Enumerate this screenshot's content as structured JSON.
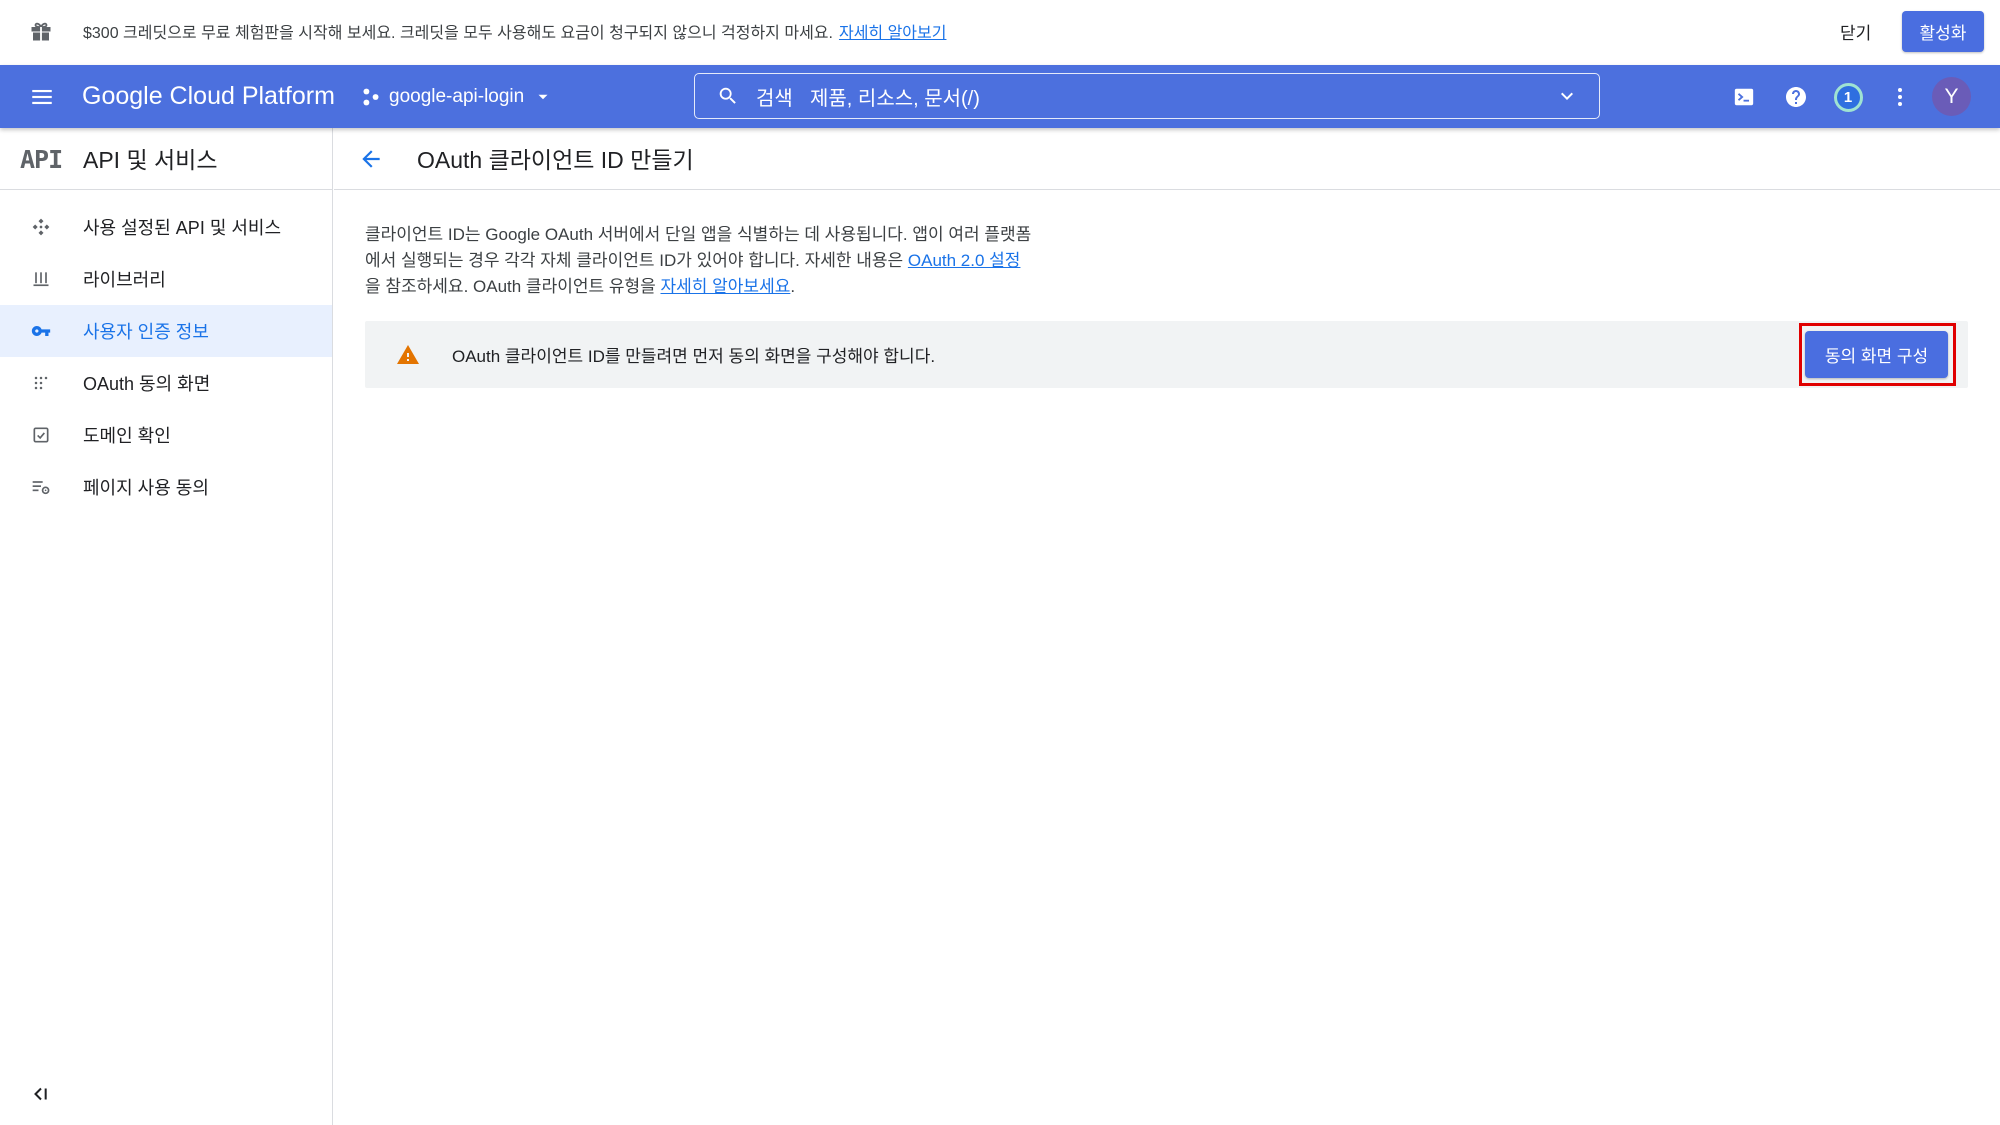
{
  "banner": {
    "gift_icon": "gift-icon",
    "text": "$300 크레딧으로 무료 체험판을 시작해 보세요. 크레딧을 모두 사용해도 요금이 청구되지 않으니 걱정하지 마세요.",
    "link": "자세히 알아보기",
    "close_label": "닫기",
    "activate_label": "활성화"
  },
  "header": {
    "menu_icon": "hamburger-menu-icon",
    "product": "Google Cloud Platform",
    "project": "google-api-login",
    "search": {
      "label": "검색",
      "hint": "제품, 리소스, 문서(/)"
    },
    "notification_count": "1",
    "avatar_initial": "Y",
    "icons": [
      "cloud-shell-icon",
      "help-icon",
      "notification-icon",
      "more-vert-icon"
    ]
  },
  "sidebar": {
    "logo": "API",
    "title": "API 및 서비스",
    "items": [
      {
        "label": "사용 설정된 API 및 서비스",
        "icon": "api-icon"
      },
      {
        "label": "라이브러리",
        "icon": "library-icon"
      },
      {
        "label": "사용자 인증 정보",
        "icon": "key-icon"
      },
      {
        "label": "OAuth 동의 화면",
        "icon": "consent-screen-icon"
      },
      {
        "label": "도메인 확인",
        "icon": "domain-check-icon"
      },
      {
        "label": "페이지 사용 동의",
        "icon": "page-usage-icon"
      }
    ]
  },
  "page": {
    "title": "OAuth 클라이언트 ID 만들기",
    "description": {
      "part1": "클라이언트 ID는 Google OAuth 서버에서 단일 앱을 식별하는 데 사용됩니다. 앱이 여러 플랫폼에서 실행되는 경우 각각 자체 클라이언트 ID가 있어야 합니다. 자세한 내용은 ",
      "link1": "OAuth 2.0 설정",
      "part2": "을 참조하세요. OAuth 클라이언트 유형을 ",
      "link2": "자세히 알아보세요",
      "part3": "."
    },
    "warning": "OAuth 클라이언트 ID를 만들려면 먼저 동의 화면을 구성해야 합니다.",
    "configure_button": "동의 화면 구성"
  },
  "colors": {
    "header_bg": "#4c70de",
    "accent": "#1a73e8",
    "warning": "#e37400",
    "highlight": "#e00000",
    "button": "#4a6ee0"
  }
}
